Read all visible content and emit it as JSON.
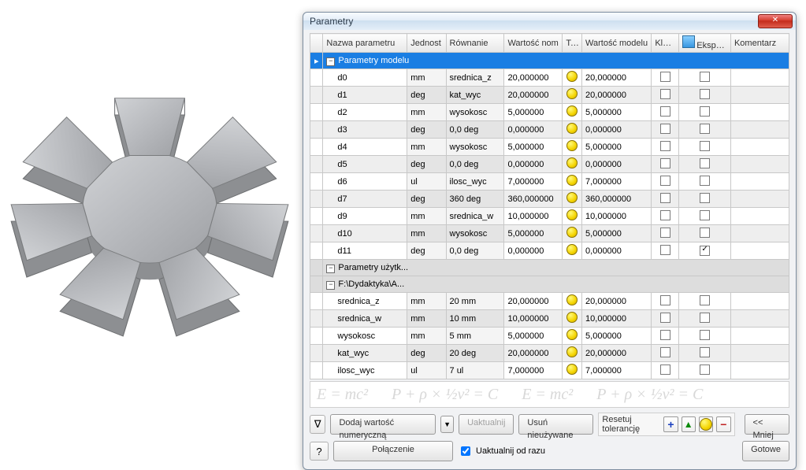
{
  "dialog": {
    "title": "Parametry",
    "columns": {
      "name": "Nazwa parametru",
      "unit": "Jednost",
      "eq": "Równanie",
      "nom": "Wartość nom",
      "tol": "Tol.",
      "model": "Wartość modelu",
      "key": "Klucz",
      "export": "Eksportuj pa",
      "comment": "Komentarz"
    },
    "sections": [
      {
        "label": "Parametry modelu",
        "selected": true,
        "rows": [
          {
            "name": "d0",
            "unit": "mm",
            "eq": "srednica_z",
            "nom": "20,000000",
            "model": "20,000000",
            "key": false,
            "export": false
          },
          {
            "name": "d1",
            "unit": "deg",
            "eq": "kat_wyc",
            "nom": "20,000000",
            "model": "20,000000",
            "key": false,
            "export": false
          },
          {
            "name": "d2",
            "unit": "mm",
            "eq": "wysokosc",
            "nom": "5,000000",
            "model": "5,000000",
            "key": false,
            "export": false
          },
          {
            "name": "d3",
            "unit": "deg",
            "eq": "0,0 deg",
            "nom": "0,000000",
            "model": "0,000000",
            "key": false,
            "export": false
          },
          {
            "name": "d4",
            "unit": "mm",
            "eq": "wysokosc",
            "nom": "5,000000",
            "model": "5,000000",
            "key": false,
            "export": false
          },
          {
            "name": "d5",
            "unit": "deg",
            "eq": "0,0 deg",
            "nom": "0,000000",
            "model": "0,000000",
            "key": false,
            "export": false
          },
          {
            "name": "d6",
            "unit": "ul",
            "eq": "ilosc_wyc",
            "nom": "7,000000",
            "model": "7,000000",
            "key": false,
            "export": false
          },
          {
            "name": "d7",
            "unit": "deg",
            "eq": "360 deg",
            "nom": "360,000000",
            "model": "360,000000",
            "key": false,
            "export": false
          },
          {
            "name": "d9",
            "unit": "mm",
            "eq": "srednica_w",
            "nom": "10,000000",
            "model": "10,000000",
            "key": false,
            "export": false
          },
          {
            "name": "d10",
            "unit": "mm",
            "eq": "wysokosc",
            "nom": "5,000000",
            "model": "5,000000",
            "key": false,
            "export": false
          },
          {
            "name": "d11",
            "unit": "deg",
            "eq": "0,0 deg",
            "nom": "0,000000",
            "model": "0,000000",
            "key": false,
            "export": true
          }
        ]
      },
      {
        "label": "Parametry użytk...",
        "rows": []
      },
      {
        "label": "F:\\Dydaktyka\\A...",
        "rows": [
          {
            "name": "srednica_z",
            "unit": "mm",
            "eq": "20 mm",
            "nom": "20,000000",
            "model": "20,000000",
            "key": false,
            "export": false
          },
          {
            "name": "srednica_w",
            "unit": "mm",
            "eq": "10 mm",
            "nom": "10,000000",
            "model": "10,000000",
            "key": false,
            "export": false
          },
          {
            "name": "wysokosc",
            "unit": "mm",
            "eq": "5 mm",
            "nom": "5,000000",
            "model": "5,000000",
            "key": false,
            "export": false
          },
          {
            "name": "kat_wyc",
            "unit": "deg",
            "eq": "20 deg",
            "nom": "20,000000",
            "model": "20,000000",
            "key": false,
            "export": false
          },
          {
            "name": "ilosc_wyc",
            "unit": "ul",
            "eq": "7 ul",
            "nom": "7,000000",
            "model": "7,000000",
            "key": false,
            "export": false
          }
        ]
      }
    ],
    "formulas": [
      "E = mc²",
      "P + ρ × ½v² = C",
      "E = mc²",
      "P + ρ × ½v² = C"
    ],
    "buttons": {
      "add_numeric": "Dodaj wartość numeryczną",
      "update": "Uaktualnij",
      "remove_unused": "Usuń nieużywane",
      "less": "<< Mniej",
      "link": "Połączenie",
      "done": "Gotowe"
    },
    "checkboxes": {
      "update_now": "Uaktualnij od razu"
    },
    "reset_tol_label": "Resetuj tolerancję"
  }
}
